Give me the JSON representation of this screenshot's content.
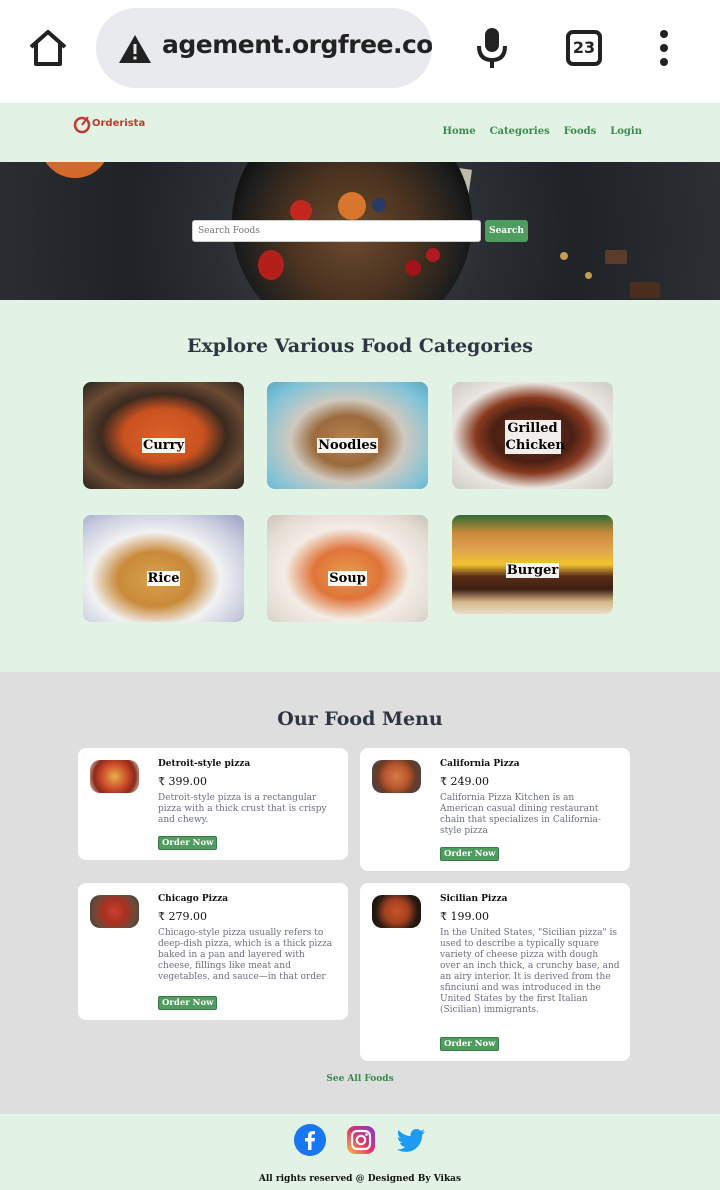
{
  "browser": {
    "url": "agement.orgfree.com",
    "tab_count": "23"
  },
  "site": {
    "logo_text": "Orderista",
    "nav": [
      "Home",
      "Categories",
      "Foods",
      "Login"
    ]
  },
  "hero": {
    "search_placeholder": "Search Foods",
    "search_button": "Search"
  },
  "categories": {
    "title": "Explore Various Food Categories",
    "items": [
      "Curry",
      "Noodles",
      "Grilled Chicken",
      "Rice",
      "Soup",
      "Burger"
    ]
  },
  "menu": {
    "title": "Our Food Menu",
    "items": [
      {
        "name": "Detroit-style pizza",
        "price": "₹ 399.00",
        "description": "Detroit-style pizza is a rectangular pizza with a thick crust that is crispy and chewy.",
        "button": "Order Now"
      },
      {
        "name": "California Pizza",
        "price": "₹ 249.00",
        "description": "California Pizza Kitchen is an American casual dining restaurant chain that specializes in California-style pizza",
        "button": "Order Now"
      },
      {
        "name": "Chicago Pizza",
        "price": "₹ 279.00",
        "description": "Chicago-style pizza usually refers to deep-dish pizza, which is a thick pizza baked in a pan and layered with cheese, fillings like meat and vegetables, and sauce—in that order",
        "button": "Order Now"
      },
      {
        "name": "Sicilian Pizza",
        "price": "₹ 199.00",
        "description": "In the United States, \"Sicilian pizza\" is used to describe a typically square variety of cheese pizza with dough over an inch thick, a crunchy base, and an airy interior. It is derived from the sfinciuni and was introduced in the United States by the first Italian (Sicilian) immigrants.",
        "button": "Order Now"
      }
    ],
    "see_all": "See All Foods"
  },
  "footer": {
    "copyright": "All rights reserved @ Designed By Vikas"
  },
  "colors": {
    "mint_background": "#e2f3e6",
    "menu_background": "#dedede",
    "accent_green": "#4e9d5f",
    "logo_red": "#c0392b"
  }
}
